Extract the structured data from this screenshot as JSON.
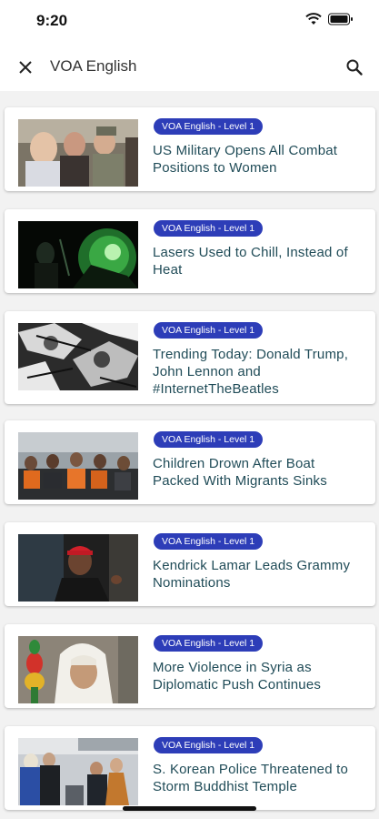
{
  "status": {
    "time": "9:20"
  },
  "search": {
    "query": "VOA English"
  },
  "articles": [
    {
      "level": "VOA English - Level 1",
      "title": "US Military Opens All Combat Positions to Women"
    },
    {
      "level": "VOA English - Level 1",
      "title": "Lasers Used to Chill, Instead of Heat"
    },
    {
      "level": "VOA English - Level 1",
      "title": "Trending Today: Donald Trump, John Lennon and #InternetTheBeatles"
    },
    {
      "level": "VOA English - Level 1",
      "title": "Children Drown After Boat Packed With Migrants Sinks"
    },
    {
      "level": "VOA English - Level 1",
      "title": "Kendrick Lamar Leads Grammy Nominations"
    },
    {
      "level": "VOA English - Level 1",
      "title": "More Violence in Syria as Diplomatic Push Continues"
    },
    {
      "level": "VOA English - Level 1",
      "title": "S. Korean Police Threatened to Storm Buddhist Temple"
    }
  ],
  "colors": {
    "badge": "#2d3db8",
    "title": "#1f4b57",
    "background": "#f2f2f2"
  },
  "icons": {
    "close": "close-icon",
    "search": "search-icon",
    "wifi": "wifi-icon",
    "battery": "battery-icon"
  }
}
